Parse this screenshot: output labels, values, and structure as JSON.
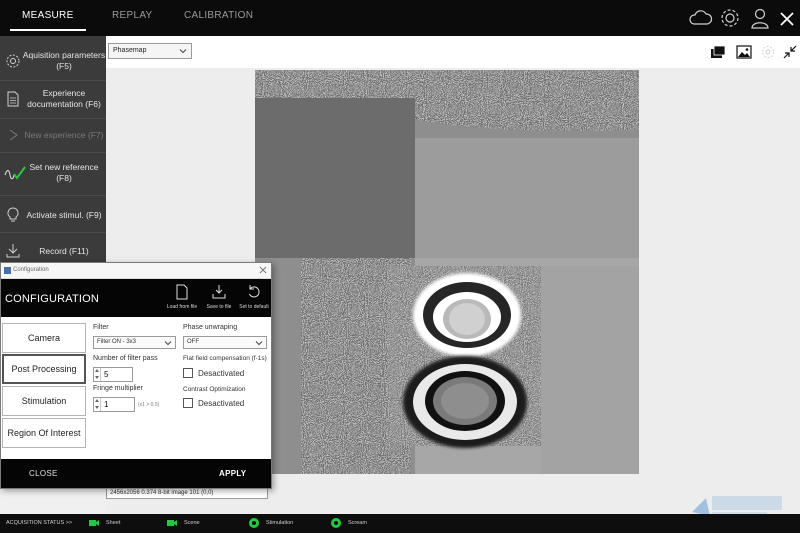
{
  "topbar": {
    "tabs": [
      "MEASURE",
      "REPLAY",
      "CALIBRATION"
    ],
    "active_tab": "MEASURE",
    "icons": [
      "cloud-icon",
      "gear-icon",
      "user-icon",
      "close-icon"
    ]
  },
  "sidebar": {
    "items": [
      {
        "label": "Aquisition parameters (F5)",
        "icon": "settings-icon",
        "enabled": true
      },
      {
        "label": "Experience documentation (F6)",
        "icon": "document-icon",
        "enabled": true
      },
      {
        "label": "New experience (F7)",
        "icon": "play-icon",
        "enabled": false
      },
      {
        "label": "Set new reference (F8)",
        "icon": "reference-wave-icon",
        "enabled": true
      },
      {
        "label": "Activate stimul. (F9)",
        "icon": "lightbulb-icon",
        "enabled": true
      },
      {
        "label": "Record (F11)",
        "icon": "download-icon",
        "enabled": true
      }
    ]
  },
  "main": {
    "view_select": "Phasemap",
    "status_field": "2456x2056 0.374 8-bit image 101 (0,0)",
    "view_icons": [
      "layers-icon",
      "image-icon",
      "settings-dim-icon",
      "collapse-icon"
    ]
  },
  "config": {
    "window_title": "Configuration",
    "title": "CONFIGURATION",
    "header_buttons": [
      "Load from file",
      "Save to file",
      "Set to default"
    ],
    "tabs": [
      "Camera",
      "Post Processing",
      "Stimulation",
      "Region Of Interest"
    ],
    "active_tab": "Post Processing",
    "filter": {
      "label": "Filter",
      "value": "Filter ON - 3x3"
    },
    "filter_pass": {
      "label": "Number of filter pass",
      "value": "5"
    },
    "fringe": {
      "label": "Fringe multiplier",
      "value": "1",
      "hint": "(x1 > 0.5)"
    },
    "phase_unwrap": {
      "label": "Phase unwraping",
      "value": "OFF"
    },
    "flat_field": {
      "label": "Flat field compensation (f-1s)",
      "value": "Desactivated",
      "checked": false
    },
    "contrast": {
      "label": "Contrast Optimization",
      "value": "Desactivated",
      "checked": false
    },
    "close_label": "CLOSE",
    "apply_label": "APPLY"
  },
  "bottombar": {
    "label": "ACQUISITION STATUS >>",
    "items": [
      {
        "label": "Sheet",
        "color": "#22c940"
      },
      {
        "label": "Scene",
        "color": "#22c940"
      },
      {
        "label": "Stimulation",
        "color": "#22c940"
      },
      {
        "label": "Scream",
        "color": "#22c940"
      }
    ]
  }
}
